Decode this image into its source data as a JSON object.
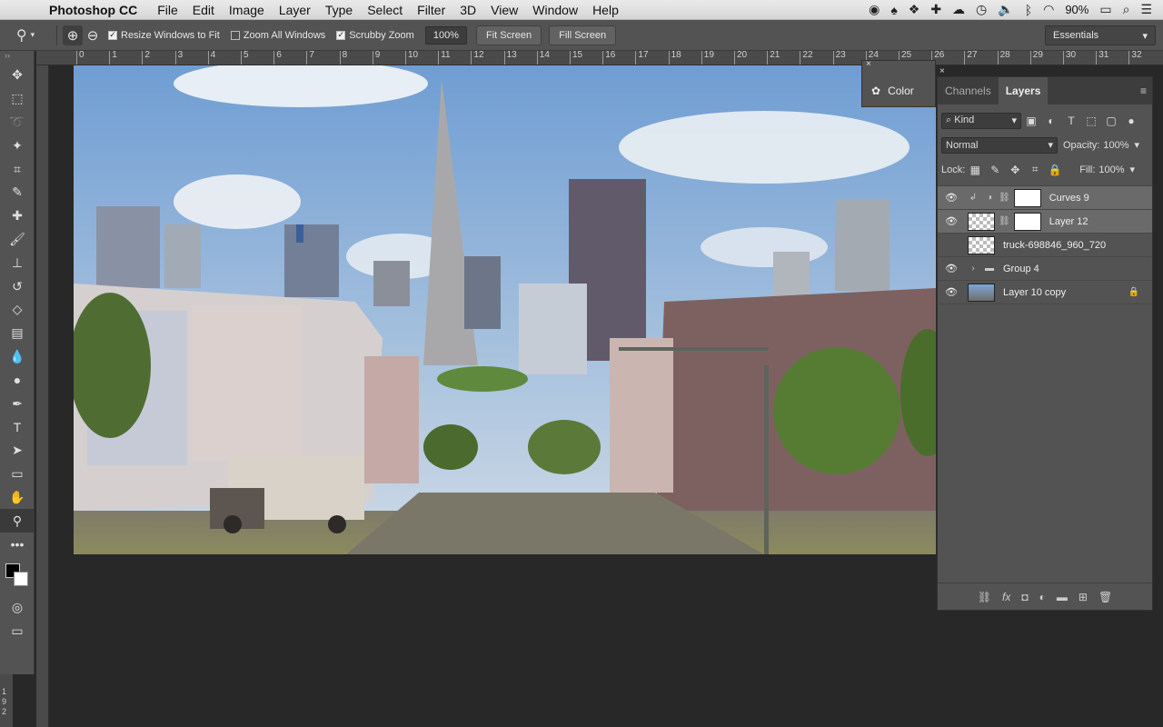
{
  "menubar": {
    "app": "Photoshop CC",
    "items": [
      "File",
      "Edit",
      "Image",
      "Layer",
      "Type",
      "Select",
      "Filter",
      "3D",
      "View",
      "Window",
      "Help"
    ],
    "battery": "90%"
  },
  "options": {
    "resize_windows": "Resize Windows to Fit",
    "zoom_all": "Zoom All Windows",
    "scrubby": "Scrubby Zoom",
    "zoom_value": "100%",
    "fit_screen": "Fit Screen",
    "fill_screen": "Fill Screen",
    "workspace": "Essentials"
  },
  "ruler": {
    "ticks": [
      "0",
      "1",
      "2",
      "3",
      "4",
      "5",
      "6",
      "7",
      "8",
      "9",
      "10",
      "11",
      "12",
      "13",
      "14",
      "15",
      "16",
      "17",
      "18",
      "19",
      "20",
      "21",
      "22",
      "23",
      "24",
      "25",
      "26",
      "27",
      "28",
      "29",
      "30",
      "31",
      "32"
    ],
    "corner_text": "1 9 2"
  },
  "color_panel": {
    "label": "Color"
  },
  "layers_panel": {
    "tabs": [
      "Channels",
      "Layers"
    ],
    "filter": "Kind",
    "blend_mode": "Normal",
    "opacity_label": "Opacity:",
    "opacity": "100%",
    "lock_label": "Lock:",
    "fill_label": "Fill:",
    "fill": "100%",
    "layers": [
      {
        "name": "Curves 9"
      },
      {
        "name": "Layer 12"
      },
      {
        "name": "truck-698846_960_720"
      },
      {
        "name": "Group 4"
      },
      {
        "name": "Layer 10 copy"
      }
    ]
  }
}
